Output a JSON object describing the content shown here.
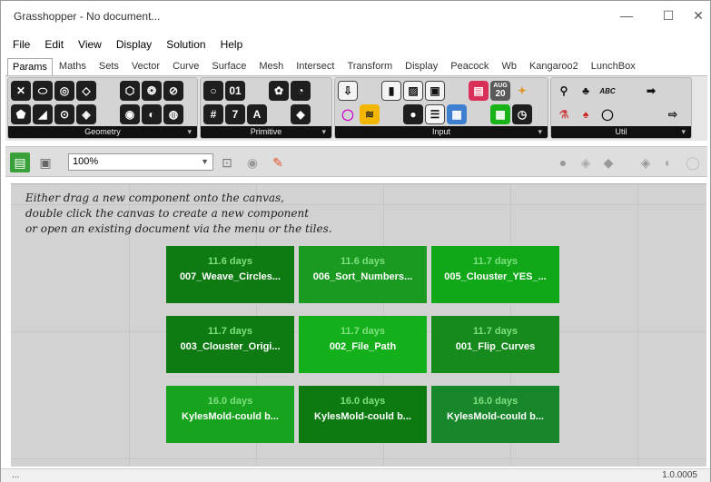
{
  "window": {
    "title": "Grasshopper - No document...",
    "minimize": "—",
    "maximize": "☐",
    "close": "✕"
  },
  "menu": [
    "File",
    "Edit",
    "View",
    "Display",
    "Solution",
    "Help"
  ],
  "tabs": [
    "Params",
    "Maths",
    "Sets",
    "Vector",
    "Curve",
    "Surface",
    "Mesh",
    "Intersect",
    "Transform",
    "Display",
    "Peacock",
    "Wb",
    "Kangaroo2",
    "LunchBox"
  ],
  "active_tab": "Params",
  "ribbon": {
    "geometry": {
      "caption": "Geometry"
    },
    "primitive": {
      "caption": "Primitive"
    },
    "input": {
      "caption": "Input",
      "calendar_month": "AUG",
      "calendar_day": "20"
    },
    "util": {
      "caption": "Util",
      "abc_label": "ABC"
    },
    "expand_glyph": "▾"
  },
  "toolbar": {
    "zoom_value": "100%"
  },
  "canvas": {
    "hint_lines": [
      "Either drag a new component onto the canvas,",
      "double click the canvas to create a new component",
      "or open an existing document via the menu or the tiles."
    ],
    "tiles": [
      {
        "age": "11.6 days",
        "name": "007_Weave_Circles...",
        "color": "#0e7a12"
      },
      {
        "age": "11.6 days",
        "name": "006_Sort_Numbers...",
        "color": "#1a9a20"
      },
      {
        "age": "11.7 days",
        "name": "005_Clouster_YES_...",
        "color": "#10a818"
      },
      {
        "age": "11.7 days",
        "name": "003_Clouster_Origi...",
        "color": "#0e7a12"
      },
      {
        "age": "11.7 days",
        "name": "002_File_Path",
        "color": "#14b01c"
      },
      {
        "age": "11.7 days",
        "name": "001_Flip_Curves",
        "color": "#168a1c"
      },
      {
        "age": "16.0 days",
        "name": "KylesMold-could  b...",
        "color": "#17a31e"
      },
      {
        "age": "16.0 days",
        "name": "KylesMold-could  b...",
        "color": "#0c7a10"
      },
      {
        "age": "16.0 days",
        "name": "KylesMold-could  b...",
        "color": "#18862a"
      }
    ]
  },
  "status": {
    "left": "...",
    "right": "1.0.0005"
  }
}
